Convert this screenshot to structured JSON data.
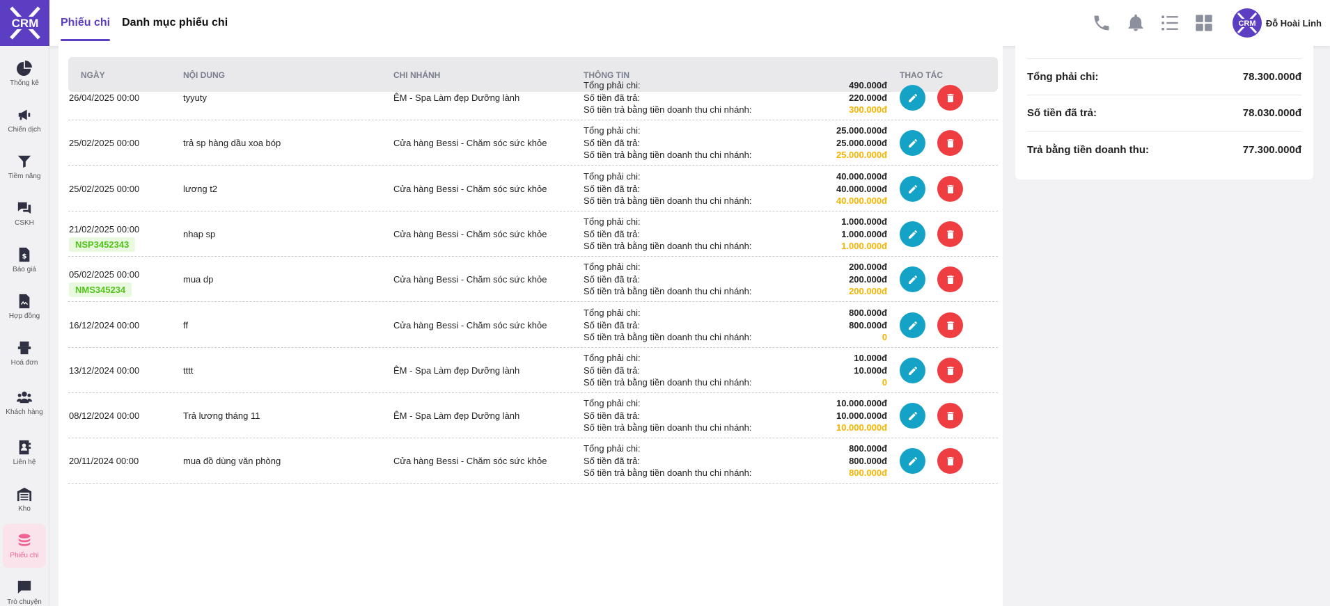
{
  "logo": {
    "text": "CRM"
  },
  "sidebar": {
    "items": [
      {
        "label": "Thống kê",
        "icon": "pie-chart-icon"
      },
      {
        "label": "Chiến dịch",
        "icon": "megaphone-icon"
      },
      {
        "label": "Tiềm năng",
        "icon": "filter-icon"
      },
      {
        "label": "CSKH",
        "icon": "chat-icon"
      },
      {
        "label": "Báo giá",
        "icon": "quote-icon"
      },
      {
        "label": "Hợp đồng",
        "icon": "contract-icon"
      },
      {
        "label": "Hoá đơn",
        "icon": "invoice-icon"
      },
      {
        "label": "Khách hàng",
        "icon": "customers-icon"
      },
      {
        "label": "Liên hệ",
        "icon": "contact-book-icon"
      },
      {
        "label": "Kho",
        "icon": "warehouse-icon"
      },
      {
        "label": "Phiếu chi",
        "icon": "coins-icon"
      },
      {
        "label": "Trò chuyện",
        "icon": "message-icon"
      }
    ]
  },
  "header": {
    "tabs": [
      {
        "label": "Phiếu chi"
      },
      {
        "label": "Danh mục phiếu chi"
      }
    ],
    "user": {
      "name": "Đỗ Hoài Linh",
      "avatar_text": "CRM"
    },
    "accent_color": "#5b3ec2"
  },
  "table": {
    "headers": {
      "date": "NGÀY",
      "content": "NỘI DUNG",
      "branch": "CHI NHÁNH",
      "info": "THÔNG TIN",
      "actions": "THAO TÁC"
    },
    "info_labels": {
      "total": "Tổng phải chi:",
      "paid": "Số tiền đã trả:",
      "revenue": "Số tiền trả bằng tiền doanh thu chi nhánh:"
    },
    "rows": [
      {
        "date": "26/04/2025 00:00",
        "code": "",
        "content": "tyyuty",
        "branch": "ÊM - Spa Làm đẹp Dưỡng lành",
        "total": "490.000đ",
        "paid": "220.000đ",
        "revenue": "300.000đ"
      },
      {
        "date": "25/02/2025 00:00",
        "code": "",
        "content": "trả sp hàng dầu xoa bóp",
        "branch": "Cửa hàng Bessi - Chăm sóc sức khỏe",
        "total": "25.000.000đ",
        "paid": "25.000.000đ",
        "revenue": "25.000.000đ"
      },
      {
        "date": "25/02/2025 00:00",
        "code": "",
        "content": "lương t2",
        "branch": "Cửa hàng Bessi - Chăm sóc sức khỏe",
        "total": "40.000.000đ",
        "paid": "40.000.000đ",
        "revenue": "40.000.000đ"
      },
      {
        "date": "21/02/2025 00:00",
        "code": "NSP3452343",
        "content": "nhap sp",
        "branch": "Cửa hàng Bessi - Chăm sóc sức khỏe",
        "total": "1.000.000đ",
        "paid": "1.000.000đ",
        "revenue": "1.000.000đ"
      },
      {
        "date": "05/02/2025 00:00",
        "code": "NMS345234",
        "content": "mua dp",
        "branch": "Cửa hàng Bessi - Chăm sóc sức khỏe",
        "total": "200.000đ",
        "paid": "200.000đ",
        "revenue": "200.000đ"
      },
      {
        "date": "16/12/2024 00:00",
        "code": "",
        "content": "ff",
        "branch": "Cửa hàng Bessi - Chăm sóc sức khỏe",
        "total": "800.000đ",
        "paid": "800.000đ",
        "revenue": "0"
      },
      {
        "date": "13/12/2024 00:00",
        "code": "",
        "content": "tttt",
        "branch": "ÊM - Spa Làm đẹp Dưỡng lành",
        "total": "10.000đ",
        "paid": "10.000đ",
        "revenue": "0"
      },
      {
        "date": "08/12/2024 00:00",
        "code": "",
        "content": "Trả lương tháng 11",
        "branch": "ÊM - Spa Làm đẹp Dưỡng lành",
        "total": "10.000.000đ",
        "paid": "10.000.000đ",
        "revenue": "10.000.000đ"
      },
      {
        "date": "20/11/2024 00:00",
        "code": "",
        "content": "mua đồ dùng văn phòng",
        "branch": "Cửa hàng Bessi - Chăm sóc sức khỏe",
        "total": "800.000đ",
        "paid": "800.000đ",
        "revenue": "800.000đ"
      }
    ]
  },
  "summary": {
    "total_label": "Tổng phải chi:",
    "total_value": "78.300.000đ",
    "paid_label": "Số tiền đã trả:",
    "paid_value": "78.030.000đ",
    "revenue_label": "Trả bằng tiền doanh thu:",
    "revenue_value": "77.300.000đ"
  }
}
